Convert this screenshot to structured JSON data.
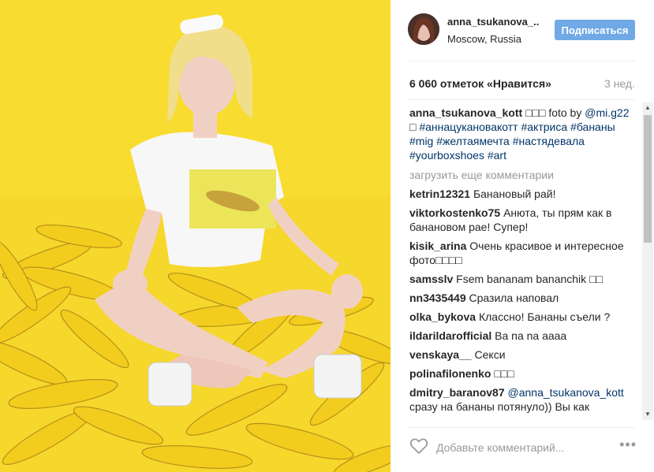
{
  "post": {
    "owner": "anna_tsukanova_..",
    "location": "Moscow, Russia",
    "follow_label": "Подписаться",
    "likes": "6 060 отметок «Нравится»",
    "time_ago": "3 нед.",
    "caption": {
      "user": "anna_tsukanova_kott",
      "parts": [
        "□□□ foto by ",
        "@mi.g22",
        " □ ",
        "#аннацукановакотт",
        " ",
        "#актриса",
        " ",
        "#бананы",
        " ",
        "#mig",
        " ",
        "#желтаямечта",
        " ",
        "#настядевала",
        " ",
        "#yourboxshoes",
        " ",
        "#art"
      ]
    },
    "load_more": "загрузить еще комментарии",
    "comments": [
      {
        "user": "ketrin12321",
        "text": "Банановый рай!"
      },
      {
        "user": "viktorkostenko75",
        "text": "Анюта, ты прям как в банановом рае! Супер!"
      },
      {
        "user": "kisik_arina",
        "text": "Очень красивое и интересное фото□□□□"
      },
      {
        "user": "samsslv",
        "text": "Fsem bananam bananchik □□"
      },
      {
        "user": "nn3435449",
        "text": "Сразила наповал"
      },
      {
        "user": "olka_bykova",
        "text": "Классно! Бананы съели ?"
      },
      {
        "user": "ildarildarofficial",
        "text": "Ва na na аааа"
      },
      {
        "user": "venskaya__",
        "text": "Секси"
      },
      {
        "user": "polinafilonenko",
        "text": "□□□"
      },
      {
        "user": "dmitry_baranov87",
        "mention": "@anna_tsukanova_kott",
        "text": "сразу на бананы потянуло)) Вы как"
      }
    ],
    "comment_placeholder": "Добавьте комментарий...",
    "more_label": "•••",
    "scroll_up": "▲",
    "scroll_down": "▼"
  },
  "icons": {
    "like": "heart-outline-icon",
    "more": "ellipsis-icon"
  },
  "colors": {
    "accent": "#70a9e6",
    "photo_background": "#f6d72b",
    "link": "#003569",
    "muted": "#999999"
  }
}
